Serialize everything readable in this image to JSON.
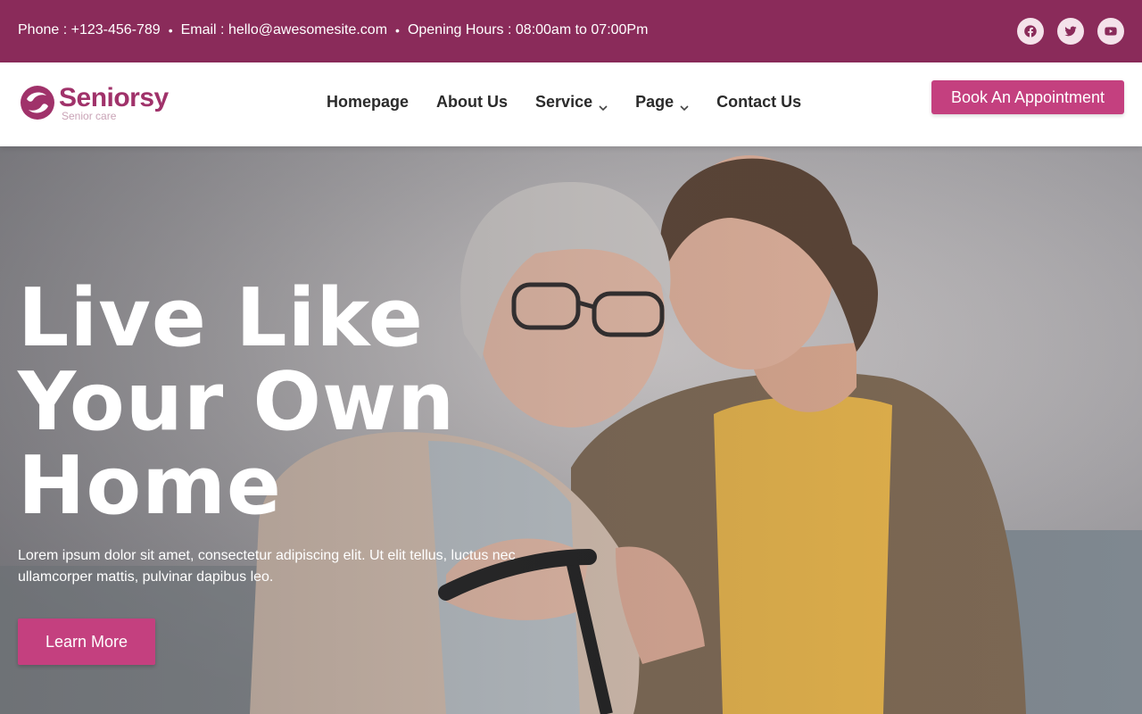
{
  "topbar": {
    "phone": "Phone : +123-456-789",
    "email": "Email : hello@awesomesite.com",
    "hours": "Opening Hours : 08:00am to 07:00Pm",
    "separator": "•",
    "background": "#8a2b5a",
    "socials": [
      {
        "icon": "facebook-icon"
      },
      {
        "icon": "twitter-icon"
      },
      {
        "icon": "youtube-icon"
      }
    ]
  },
  "brand": {
    "name": "Seniorsy",
    "tagline": "Senior care",
    "color": "#a0326a"
  },
  "nav": {
    "items": [
      {
        "label": "Homepage",
        "dropdown": false
      },
      {
        "label": "About Us",
        "dropdown": false
      },
      {
        "label": "Service",
        "dropdown": true
      },
      {
        "label": "Page",
        "dropdown": true
      },
      {
        "label": "Contact Us",
        "dropdown": false
      }
    ]
  },
  "header": {
    "cta_label": "Book An Appointment",
    "accent": "#c4407f"
  },
  "hero": {
    "headline_line1": "Live Like",
    "headline_line2": "Your Own",
    "headline_line3": "Home",
    "subtext": "Lorem ipsum dolor sit amet, consectetur adipiscing elit. Ut elit tellus, luctus nec ullamcorper mattis, pulvinar dapibus leo.",
    "cta_label": "Learn More"
  }
}
